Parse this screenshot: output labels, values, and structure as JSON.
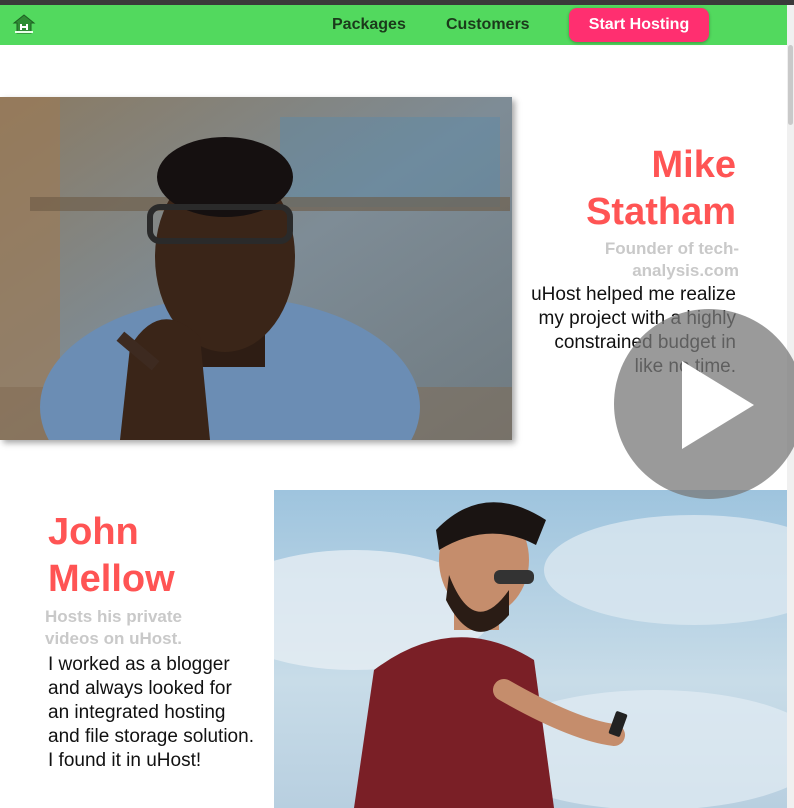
{
  "header": {
    "nav": {
      "packages": "Packages",
      "customers": "Customers"
    },
    "cta": "Start Hosting"
  },
  "testimonials": [
    {
      "name_line1": "Mike",
      "name_line2": "Statham",
      "role": "Founder of tech-analysis.com",
      "quote": "uHost helped me realize my project with a highly constrained budget in like no time."
    },
    {
      "name_line1": "John",
      "name_line2": "Mellow",
      "role": "Hosts his private videos on uHost.",
      "quote": "I worked as a blogger and always looked for an integrated hosting and file storage solution. I found it in uHost!"
    }
  ],
  "colors": {
    "header": "#52d95e",
    "accent": "#ff2f70",
    "name": "#ff5454",
    "role": "#c9c9c9"
  },
  "icons": [
    "uhost-logo-icon",
    "play-icon"
  ]
}
